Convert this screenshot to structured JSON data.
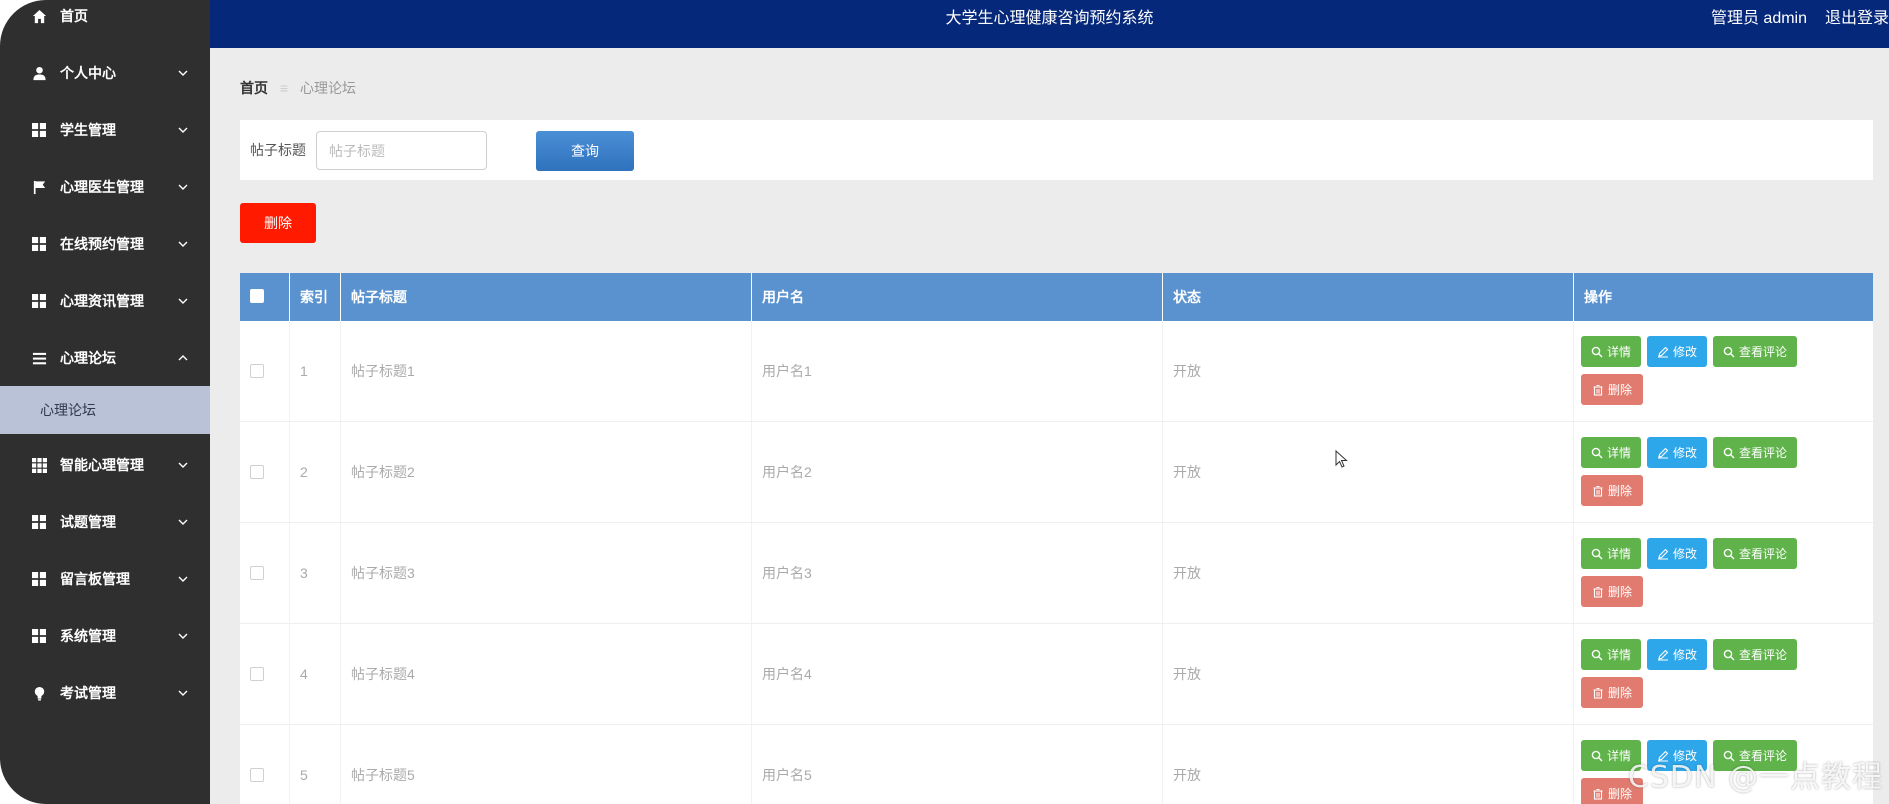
{
  "header": {
    "title": "大学生心理健康咨询预约系统",
    "role": "管理员 admin",
    "logout": "退出登录"
  },
  "sidebar": {
    "items": [
      {
        "label": "首页",
        "icon": "home-icon",
        "has_arrow": false
      },
      {
        "label": "个人中心",
        "icon": "user-icon",
        "has_arrow": true
      },
      {
        "label": "学生管理",
        "icon": "grid-icon",
        "has_arrow": true
      },
      {
        "label": "心理医生管理",
        "icon": "flag-icon",
        "has_arrow": true
      },
      {
        "label": "在线预约管理",
        "icon": "grid-icon",
        "has_arrow": true
      },
      {
        "label": "心理资讯管理",
        "icon": "grid-icon",
        "has_arrow": true
      },
      {
        "label": "心理论坛",
        "icon": "list-icon",
        "has_arrow": true,
        "expanded": true
      },
      {
        "label": "智能心理管理",
        "icon": "table-icon",
        "has_arrow": true
      },
      {
        "label": "试题管理",
        "icon": "grid-icon",
        "has_arrow": true
      },
      {
        "label": "留言板管理",
        "icon": "grid-icon",
        "has_arrow": true
      },
      {
        "label": "系统管理",
        "icon": "grid-icon",
        "has_arrow": true
      },
      {
        "label": "考试管理",
        "icon": "bulb-icon",
        "has_arrow": true
      }
    ],
    "sub_item": "心理论坛"
  },
  "breadcrumb": {
    "home": "首页",
    "sep": "≡",
    "current": "心理论坛"
  },
  "search": {
    "label": "帖子标题",
    "placeholder": "帖子标题",
    "query_button": "查询"
  },
  "delete_button": "删除",
  "table": {
    "headers": [
      "索引",
      "帖子标题",
      "用户名",
      "状态",
      "操作"
    ],
    "rows": [
      {
        "index": "1",
        "title": "帖子标题1",
        "user": "用户名1",
        "status": "开放"
      },
      {
        "index": "2",
        "title": "帖子标题2",
        "user": "用户名2",
        "status": "开放"
      },
      {
        "index": "3",
        "title": "帖子标题3",
        "user": "用户名3",
        "status": "开放"
      },
      {
        "index": "4",
        "title": "帖子标题4",
        "user": "用户名4",
        "status": "开放"
      },
      {
        "index": "5",
        "title": "帖子标题5",
        "user": "用户名5",
        "status": "开放"
      }
    ],
    "actions": {
      "detail": "详情",
      "edit": "修改",
      "comments": "查看评论",
      "delete": "删除"
    }
  },
  "watermark": "CSDN @一点教程",
  "colors": {
    "sidebar": "#2f2f2f",
    "header": "#06287a",
    "table_header": "#5a92cf",
    "green": "#5fb34a",
    "blue": "#2ea7ea",
    "red": "#e27b6f",
    "delete": "#ff1a00"
  }
}
